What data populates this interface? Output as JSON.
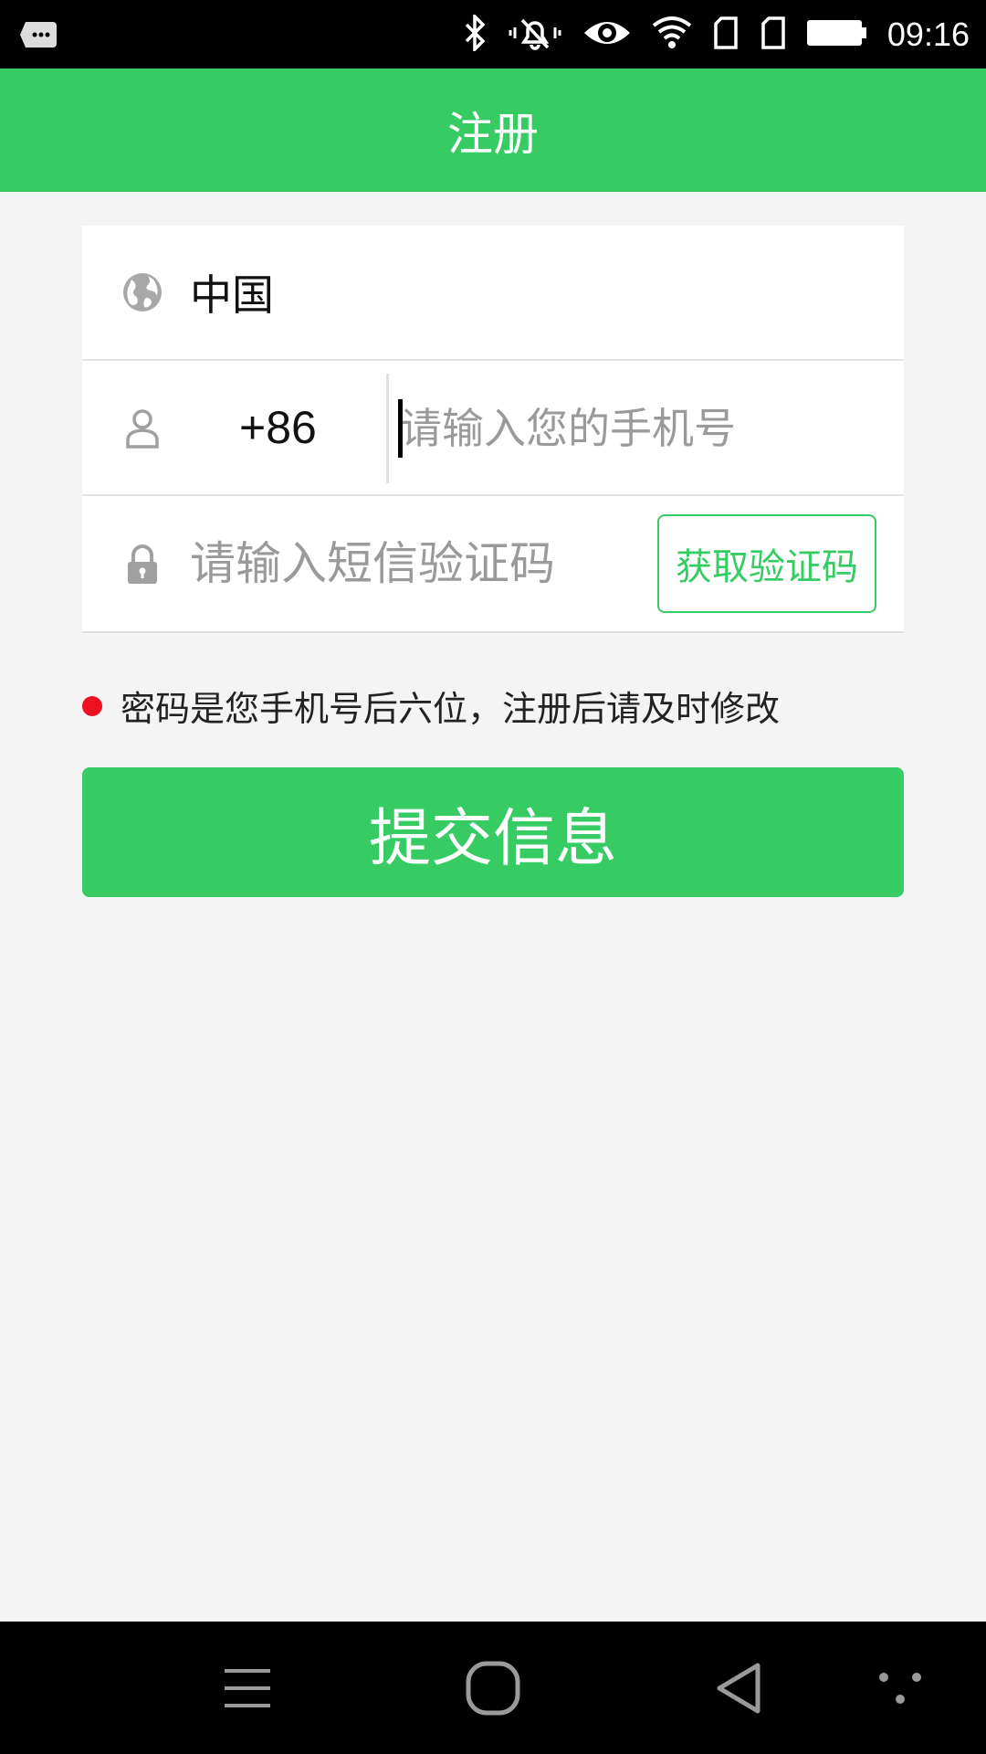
{
  "status_bar": {
    "time": "09:16",
    "icons": [
      "notification-icon",
      "bluetooth-icon",
      "vibrate-icon",
      "eye-icon",
      "wifi-icon",
      "sim-icon",
      "sim-icon",
      "battery-icon"
    ]
  },
  "app_bar": {
    "title": "注册"
  },
  "form": {
    "country": {
      "icon": "globe-icon",
      "value": "中国"
    },
    "phone": {
      "icon": "user-icon",
      "prefix": "+86",
      "placeholder": "请输入您的手机号"
    },
    "sms": {
      "icon": "lock-icon",
      "placeholder": "请输入短信验证码",
      "button_label": "获取验证码"
    }
  },
  "notice": {
    "text": "密码是您手机号后六位，注册后请及时修改",
    "dot_color": "#ee1122"
  },
  "submit": {
    "label": "提交信息"
  },
  "colors": {
    "accent": "#36cc63"
  },
  "nav_bar": {
    "icons": [
      "menu-icon",
      "home-icon",
      "back-icon",
      "more-icon"
    ]
  }
}
